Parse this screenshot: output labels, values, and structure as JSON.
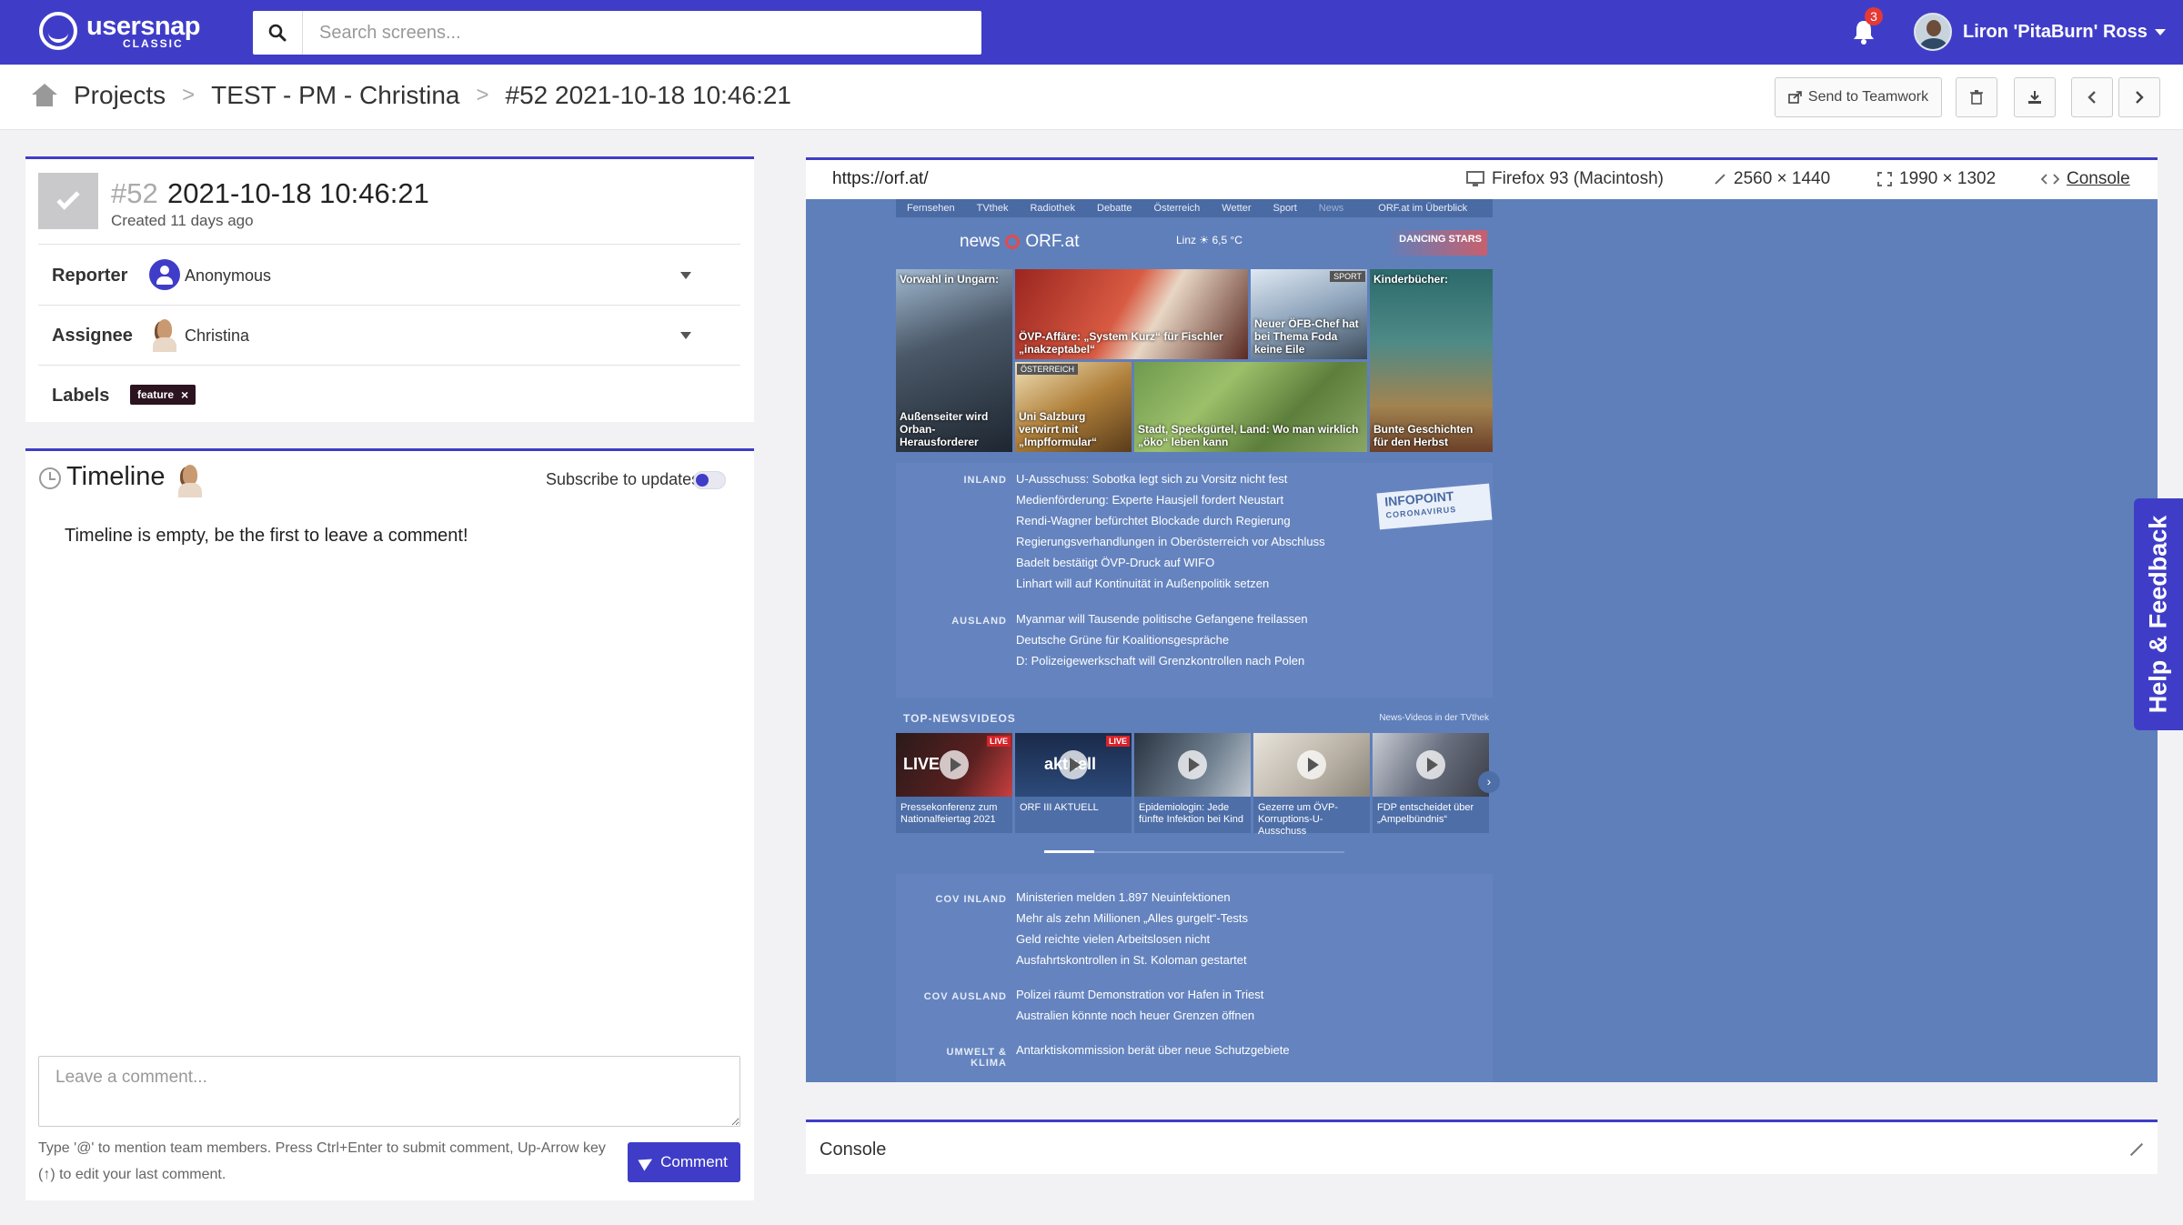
{
  "app": {
    "logo_main": "usersnap",
    "logo_sub": "CLASSIC"
  },
  "search": {
    "placeholder": "Search screens..."
  },
  "notifications": {
    "count": "3"
  },
  "user": {
    "name": "Liron 'PitaBurn' Ross"
  },
  "breadcrumb": {
    "items": [
      "Projects",
      "TEST - PM - Christina",
      "#52 2021-10-18 10:46:21"
    ],
    "sep": ">"
  },
  "toolbar": {
    "send_label": "Send to Teamwork"
  },
  "issue": {
    "number": "#52",
    "title": "2021-10-18 10:46:21",
    "created": "Created 11 days ago",
    "reporter_label": "Reporter",
    "reporter": "Anonymous",
    "assignee_label": "Assignee",
    "assignee": "Christina",
    "labels_label": "Labels",
    "label_tag": "feature",
    "label_remove": "×"
  },
  "timeline": {
    "title": "Timeline",
    "subscribe": "Subscribe to updates",
    "empty": "Timeline is empty, be the first to leave a comment!"
  },
  "comment": {
    "placeholder": "Leave a comment...",
    "hint": "Type '@' to mention team members. Press Ctrl+Enter to submit comment, Up-Arrow key (↑) to edit your last comment.",
    "button": "Comment"
  },
  "screenshot": {
    "url": "https://orf.at/",
    "browser": "Firefox 93 (Macintosh)",
    "screen": "2560 × 1440",
    "viewport": "1990 × 1302",
    "console_link": "Console"
  },
  "orf": {
    "nav": [
      "Fernsehen",
      "TVthek",
      "Radiothek",
      "Debatte",
      "Österreich",
      "Wetter",
      "Sport",
      "News",
      "ORF.at im Überblick"
    ],
    "brand_news": "news",
    "brand_orf": "ORF.at",
    "weather": "Linz ☀ 6,5 °C",
    "promo": "DANCING STARS",
    "tiles": {
      "t1_top": "Vorwahl in Ungarn:",
      "t1_cap": "Außenseiter wird Orban-Herausforderer",
      "t2_cap": "ÖVP-Affäre: „System Kurz“ für Fischler „inakzeptabel“",
      "t3_tag": "SPORT",
      "t3_cap": "Neuer ÖFB-Chef hat bei Thema Foda keine Eile",
      "t4_top": "Kinderbücher:",
      "t4_cap": "Bunte Geschichten für den Herbst",
      "t5_tag": "ÖSTERREICH",
      "t5_cap": "Uni Salzburg verwirrt mit „Impfformular“",
      "t6_cap": "Stadt, Speckgürtel, Land: Wo man wirklich „öko“ leben kann"
    },
    "inland_label": "INLAND",
    "inland": [
      "U-Ausschuss: Sobotka legt sich zu Vorsitz nicht fest",
      "Medienförderung: Experte Hausjell fordert Neustart",
      "Rendi-Wagner befürchtet Blockade durch Regierung",
      "Regierungsverhandlungen in Oberösterreich vor Abschluss",
      "Badelt bestätigt ÖVP-Druck auf WIFO",
      "Linhart will auf Kontinuität in Außenpolitik setzen"
    ],
    "infopoint": "INFOPOINT",
    "infopoint_sub": "CORONAVIRUS",
    "ausland_label": "AUSLAND",
    "ausland": [
      "Myanmar will Tausende politische Gefangene freilassen",
      "Deutsche Grüne für Koalitionsgespräche",
      "D: Polizeigewerkschaft will Grenzkontrollen nach Polen"
    ],
    "videos_head": "TOP-NEWSVIDEOS",
    "videos_more": "News-Videos in der TVthek",
    "videos": [
      {
        "cap": "Pressekonferenz zum Nationalfeiertag 2021",
        "live": "LIVE",
        "img": "LIVE"
      },
      {
        "cap": "ORF III AKTUELL",
        "live": "LIVE",
        "img": "aktuell"
      },
      {
        "cap": "Epidemiologin: Jede fünfte Infektion bei Kind",
        "live": "",
        "img": ""
      },
      {
        "cap": "Gezerre um ÖVP-Korruptions-U-Ausschuss",
        "live": "",
        "img": ""
      },
      {
        "cap": "FDP entscheidet über „Ampelbündnis“",
        "live": "",
        "img": ""
      }
    ],
    "cov_inland_label": "COV INLAND",
    "cov_inland": [
      "Ministerien melden 1.897 Neuinfektionen",
      "Mehr als zehn Millionen „Alles gurgelt“-Tests",
      "Geld reichte vielen Arbeitslosen nicht",
      "Ausfahrtskontrollen in St. Koloman gestartet"
    ],
    "cov_ausland_label": "COV AUSLAND",
    "cov_ausland": [
      "Polizei räumt Demonstration vor Hafen in Triest",
      "Australien könnte noch heuer Grenzen öffnen"
    ],
    "umwelt_label": "UMWELT & KLIMA",
    "umwelt": [
      "Antarktiskommission berät über neue Schutzgebiete"
    ]
  },
  "console_panel": {
    "title": "Console"
  },
  "help": {
    "label": "Help & Feedback"
  }
}
